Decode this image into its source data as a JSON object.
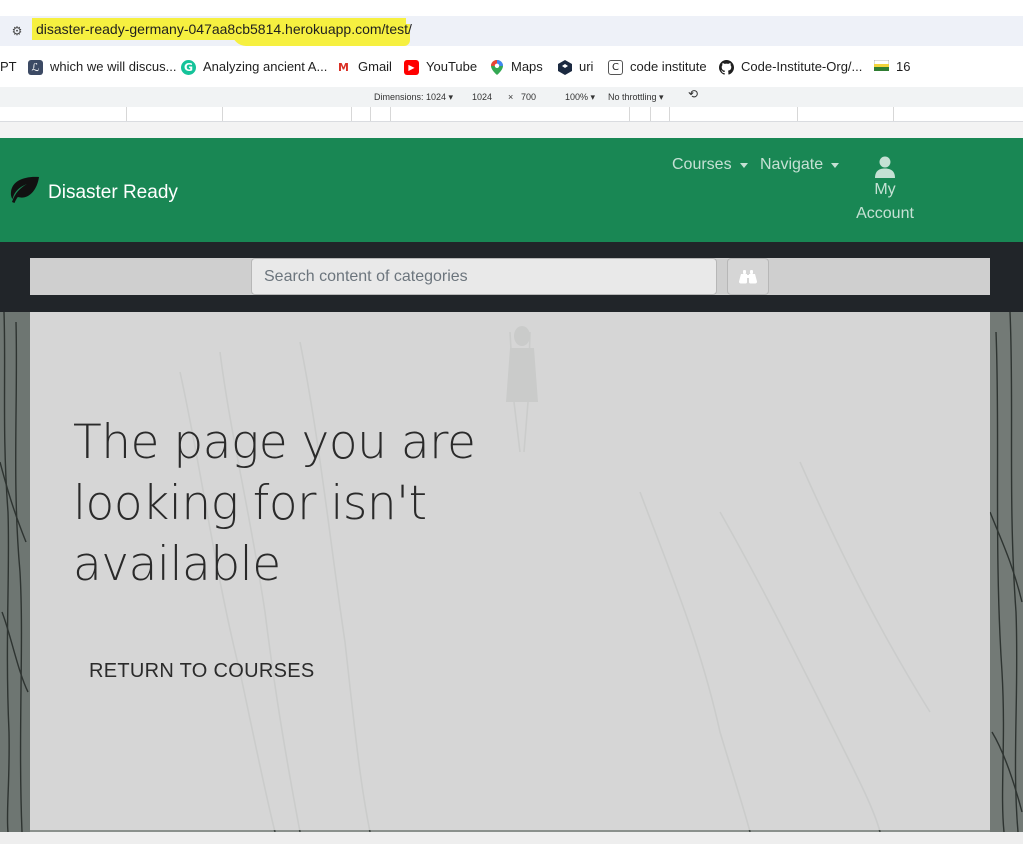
{
  "browser": {
    "url": "disaster-ready-germany-047aa8cb5814.herokuapp.com/test/",
    "highlight_color": "#f6f040",
    "bookmarks": [
      {
        "label": "PT",
        "icon": "none"
      },
      {
        "label": "which we will discus...",
        "icon": "script-l-icon"
      },
      {
        "label": "Analyzing ancient A...",
        "icon": "grammarly-icon"
      },
      {
        "label": "Gmail",
        "icon": "gmail-icon"
      },
      {
        "label": "YouTube",
        "icon": "youtube-icon"
      },
      {
        "label": "Maps",
        "icon": "maps-pin-icon"
      },
      {
        "label": "uri",
        "icon": "hex-icon"
      },
      {
        "label": "code institute",
        "icon": "code-institute-icon"
      },
      {
        "label": "Code-Institute-Org/...",
        "icon": "github-icon"
      },
      {
        "label": "16",
        "icon": "flag-icon"
      }
    ]
  },
  "devtools": {
    "dimensions_label": "Dimensions: 1024",
    "width": "1024",
    "times": "×",
    "height": "700",
    "zoom": "100%",
    "throttling": "No throttling"
  },
  "site": {
    "brand": "Disaster Ready",
    "brand_color": "#198754",
    "nav": {
      "courses": "Courses",
      "navigate": "Navigate",
      "account_line1": "My",
      "account_line2": "Account"
    },
    "search": {
      "placeholder": "Search content of categories"
    },
    "error": {
      "title": "The page you are looking for isn't available",
      "return_link": "RETURN TO COURSES"
    }
  }
}
